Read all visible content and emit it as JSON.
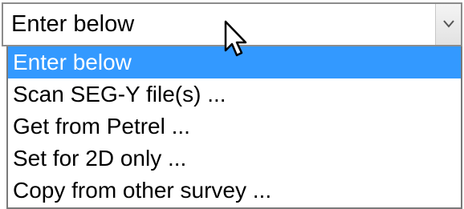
{
  "combo": {
    "value": "Enter below",
    "arrow_icon": "chevron-down-icon"
  },
  "dropdown": {
    "selected_index": 0,
    "options": [
      "Enter below",
      "Scan SEG-Y file(s) ...",
      "Get from Petrel ...",
      "Set for 2D only ...",
      "Copy from other survey ..."
    ]
  },
  "cursor": {
    "icon": "mouse-pointer-icon"
  },
  "colors": {
    "selection_highlight": "#3399ff",
    "selection_text": "#ffffff",
    "border": "#7a7a7a"
  }
}
